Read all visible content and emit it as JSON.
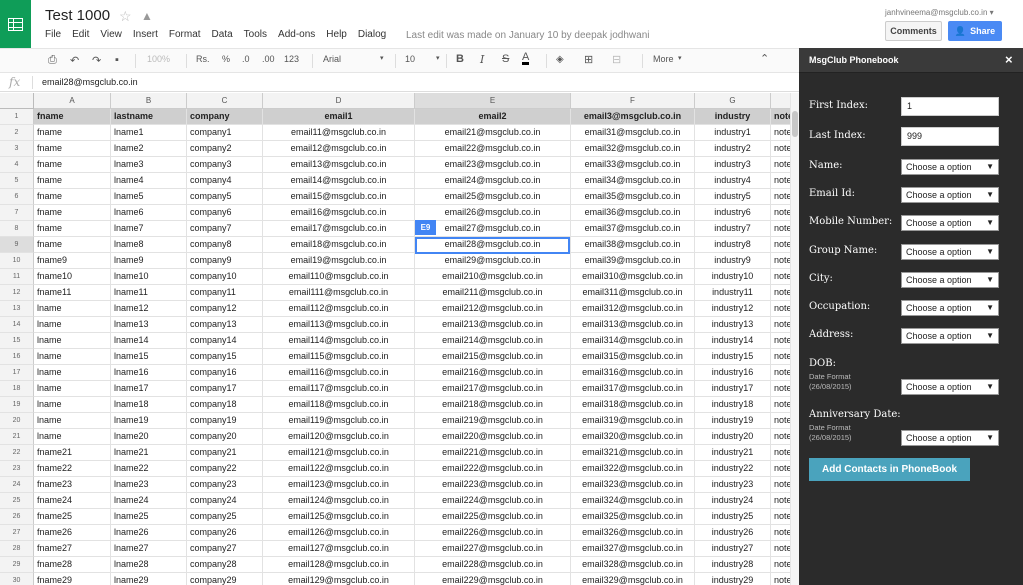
{
  "header": {
    "title": "Test 1000",
    "menu": [
      "File",
      "Edit",
      "View",
      "Insert",
      "Format",
      "Data",
      "Tools",
      "Add-ons",
      "Help",
      "Dialog"
    ],
    "last_edit": "Last edit was made on January 10 by deepak jodhwani",
    "account": "janhvineema@msgclub.co.in",
    "comments_label": "Comments",
    "share_label": "Share"
  },
  "toolbar": {
    "zoom": "100%",
    "currency": "Rs.",
    "percent": "%",
    "dec_less": ".0",
    "dec_more": ".00",
    "more_formats": "123",
    "font": "Arial",
    "font_size": "10",
    "bold": "B",
    "italic": "I",
    "strike": "S",
    "text_color": "A",
    "more": "More"
  },
  "formula_bar": {
    "fx": "fx",
    "value": "email28@msgclub.co.in"
  },
  "selected_cell": "E9",
  "columns": [
    "A",
    "B",
    "C",
    "D",
    "E",
    "F",
    "G",
    ""
  ],
  "header_row": [
    "fname",
    "lastname",
    "company",
    "email1",
    "email2",
    "email3@msgclub.co.in",
    "industry",
    "note"
  ],
  "rows": [
    [
      "1",
      "fname",
      "lname1",
      "company1",
      "email11@msgclub.co.in",
      "email21@msgclub.co.in",
      "email31@msgclub.co.in",
      "industry1",
      "note"
    ],
    [
      "3",
      "fname",
      "lname2",
      "company2",
      "email12@msgclub.co.in",
      "email22@msgclub.co.in",
      "email32@msgclub.co.in",
      "industry2",
      "note"
    ],
    [
      "4",
      "fname",
      "lname3",
      "company3",
      "email13@msgclub.co.in",
      "email23@msgclub.co.in",
      "email33@msgclub.co.in",
      "industry3",
      "note"
    ],
    [
      "5",
      "fname",
      "lname4",
      "company4",
      "email14@msgclub.co.in",
      "email24@msgclub.co.in",
      "email34@msgclub.co.in",
      "industry4",
      "note"
    ],
    [
      "6",
      "fname",
      "lname5",
      "company5",
      "email15@msgclub.co.in",
      "email25@msgclub.co.in",
      "email35@msgclub.co.in",
      "industry5",
      "note"
    ],
    [
      "7",
      "fname",
      "lname6",
      "company6",
      "email16@msgclub.co.in",
      "email26@msgclub.co.in",
      "email36@msgclub.co.in",
      "industry6",
      "note"
    ],
    [
      "8",
      "fname",
      "lname7",
      "company7",
      "email17@msgclub.co.in",
      "email27@msgclub.co.in",
      "email37@msgclub.co.in",
      "industry7",
      "note"
    ],
    [
      "9",
      "fname",
      "lname8",
      "company8",
      "email18@msgclub.co.in",
      "email28@msgclub.co.in",
      "email38@msgclub.co.in",
      "industry8",
      "note"
    ],
    [
      "10",
      "fname9",
      "lname9",
      "company9",
      "email19@msgclub.co.in",
      "email29@msgclub.co.in",
      "email39@msgclub.co.in",
      "industry9",
      "note"
    ],
    [
      "11",
      "fname10",
      "lname10",
      "company10",
      "email110@msgclub.co.in",
      "email210@msgclub.co.in",
      "email310@msgclub.co.in",
      "industry10",
      "note"
    ],
    [
      "12",
      "fname11",
      "lname11",
      "company11",
      "email111@msgclub.co.in",
      "email211@msgclub.co.in",
      "email311@msgclub.co.in",
      "industry11",
      "note"
    ],
    [
      "13",
      "lname",
      "lname12",
      "company12",
      "email112@msgclub.co.in",
      "email212@msgclub.co.in",
      "email312@msgclub.co.in",
      "industry12",
      "note"
    ],
    [
      "14",
      "lname",
      "lname13",
      "company13",
      "email113@msgclub.co.in",
      "email213@msgclub.co.in",
      "email313@msgclub.co.in",
      "industry13",
      "note"
    ],
    [
      "15",
      "lname",
      "lname14",
      "company14",
      "email114@msgclub.co.in",
      "email214@msgclub.co.in",
      "email314@msgclub.co.in",
      "industry14",
      "note"
    ],
    [
      "16",
      "lname",
      "lname15",
      "company15",
      "email115@msgclub.co.in",
      "email215@msgclub.co.in",
      "email315@msgclub.co.in",
      "industry15",
      "note"
    ],
    [
      "17",
      "lname",
      "lname16",
      "company16",
      "email116@msgclub.co.in",
      "email216@msgclub.co.in",
      "email316@msgclub.co.in",
      "industry16",
      "note"
    ],
    [
      "18",
      "lname",
      "lname17",
      "company17",
      "email117@msgclub.co.in",
      "email217@msgclub.co.in",
      "email317@msgclub.co.in",
      "industry17",
      "note"
    ],
    [
      "19",
      "lname",
      "lname18",
      "company18",
      "email118@msgclub.co.in",
      "email218@msgclub.co.in",
      "email318@msgclub.co.in",
      "industry18",
      "note"
    ],
    [
      "20",
      "lname",
      "lname19",
      "company19",
      "email119@msgclub.co.in",
      "email219@msgclub.co.in",
      "email319@msgclub.co.in",
      "industry19",
      "note"
    ],
    [
      "21",
      "lname",
      "lname20",
      "company20",
      "email120@msgclub.co.in",
      "email220@msgclub.co.in",
      "email320@msgclub.co.in",
      "industry20",
      "note"
    ],
    [
      "22",
      "fname21",
      "lname21",
      "company21",
      "email121@msgclub.co.in",
      "email221@msgclub.co.in",
      "email321@msgclub.co.in",
      "industry21",
      "note"
    ],
    [
      "23",
      "fname22",
      "lname22",
      "company22",
      "email122@msgclub.co.in",
      "email222@msgclub.co.in",
      "email322@msgclub.co.in",
      "industry22",
      "note"
    ],
    [
      "24",
      "fname23",
      "lname23",
      "company23",
      "email123@msgclub.co.in",
      "email223@msgclub.co.in",
      "email323@msgclub.co.in",
      "industry23",
      "note"
    ],
    [
      "25",
      "fname24",
      "lname24",
      "company24",
      "email124@msgclub.co.in",
      "email224@msgclub.co.in",
      "email324@msgclub.co.in",
      "industry24",
      "note"
    ],
    [
      "26",
      "fname25",
      "lname25",
      "company25",
      "email125@msgclub.co.in",
      "email225@msgclub.co.in",
      "email325@msgclub.co.in",
      "industry25",
      "note"
    ],
    [
      "27",
      "fname26",
      "lname26",
      "company26",
      "email126@msgclub.co.in",
      "email226@msgclub.co.in",
      "email326@msgclub.co.in",
      "industry26",
      "note"
    ],
    [
      "28",
      "fname27",
      "lname27",
      "company27",
      "email127@msgclub.co.in",
      "email227@msgclub.co.in",
      "email327@msgclub.co.in",
      "industry27",
      "note"
    ],
    [
      "29",
      "fname28",
      "lname28",
      "company28",
      "email128@msgclub.co.in",
      "email228@msgclub.co.in",
      "email328@msgclub.co.in",
      "industry28",
      "note"
    ],
    [
      "30",
      "fname29",
      "lname29",
      "company29",
      "email129@msgclub.co.in",
      "email229@msgclub.co.in",
      "email329@msgclub.co.in",
      "industry29",
      "note"
    ]
  ],
  "sidebar": {
    "title": "MsgClub Phonebook",
    "close": "×",
    "first_index_label": "First Index:",
    "first_index_value": "1",
    "last_index_label": "Last Index:",
    "last_index_value": "999",
    "fields": [
      {
        "label": "Name:",
        "value": "Choose a option"
      },
      {
        "label": "Email Id:",
        "value": "Choose a option"
      },
      {
        "label": "Mobile Number:",
        "value": "Choose a option"
      },
      {
        "label": "Group Name:",
        "value": "Choose a option"
      },
      {
        "label": "City:",
        "value": "Choose a option"
      },
      {
        "label": "Occupation:",
        "value": "Choose a option"
      },
      {
        "label": "Address:",
        "value": "Choose a option"
      }
    ],
    "dob": {
      "label": "DOB:",
      "sub": "Date Format (26/08/2015)",
      "value": "Choose a option"
    },
    "anniversary": {
      "label": "Anniversary Date:",
      "sub": "Date Format (26/08/2015)",
      "value": "Choose a option"
    },
    "add_button": "Add Contacts in PhoneBook"
  },
  "colors": {
    "sheets_green": "#0f9d58",
    "share_blue": "#4a8af4",
    "selection_blue": "#4285f4",
    "sidebar_bg": "#2b2b2b",
    "add_button": "#4aa3bd"
  }
}
